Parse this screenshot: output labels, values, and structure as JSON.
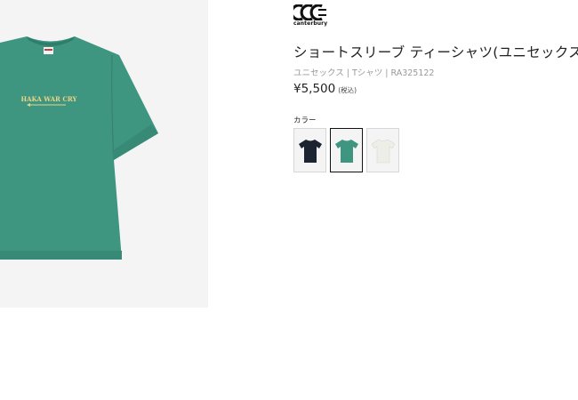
{
  "brand": {
    "name": "canterbury"
  },
  "product": {
    "title": "ショートスリーブ ティーシャツ(ユニセックス)",
    "meta": "ユニセックス | Tシャツ | RA325122",
    "price": "¥5,500",
    "tax_label": "(税込)",
    "print_text": "HAKA WAR CRY"
  },
  "colors": {
    "label": "カラー",
    "options": [
      {
        "name": "navy",
        "hex": "#1d2431",
        "selected": false
      },
      {
        "name": "green",
        "hex": "#3e9580",
        "selected": true
      },
      {
        "name": "white",
        "hex": "#eeeee8",
        "selected": false
      }
    ]
  },
  "accent": {
    "garment": "#3e9580",
    "print": "#e8d488"
  }
}
